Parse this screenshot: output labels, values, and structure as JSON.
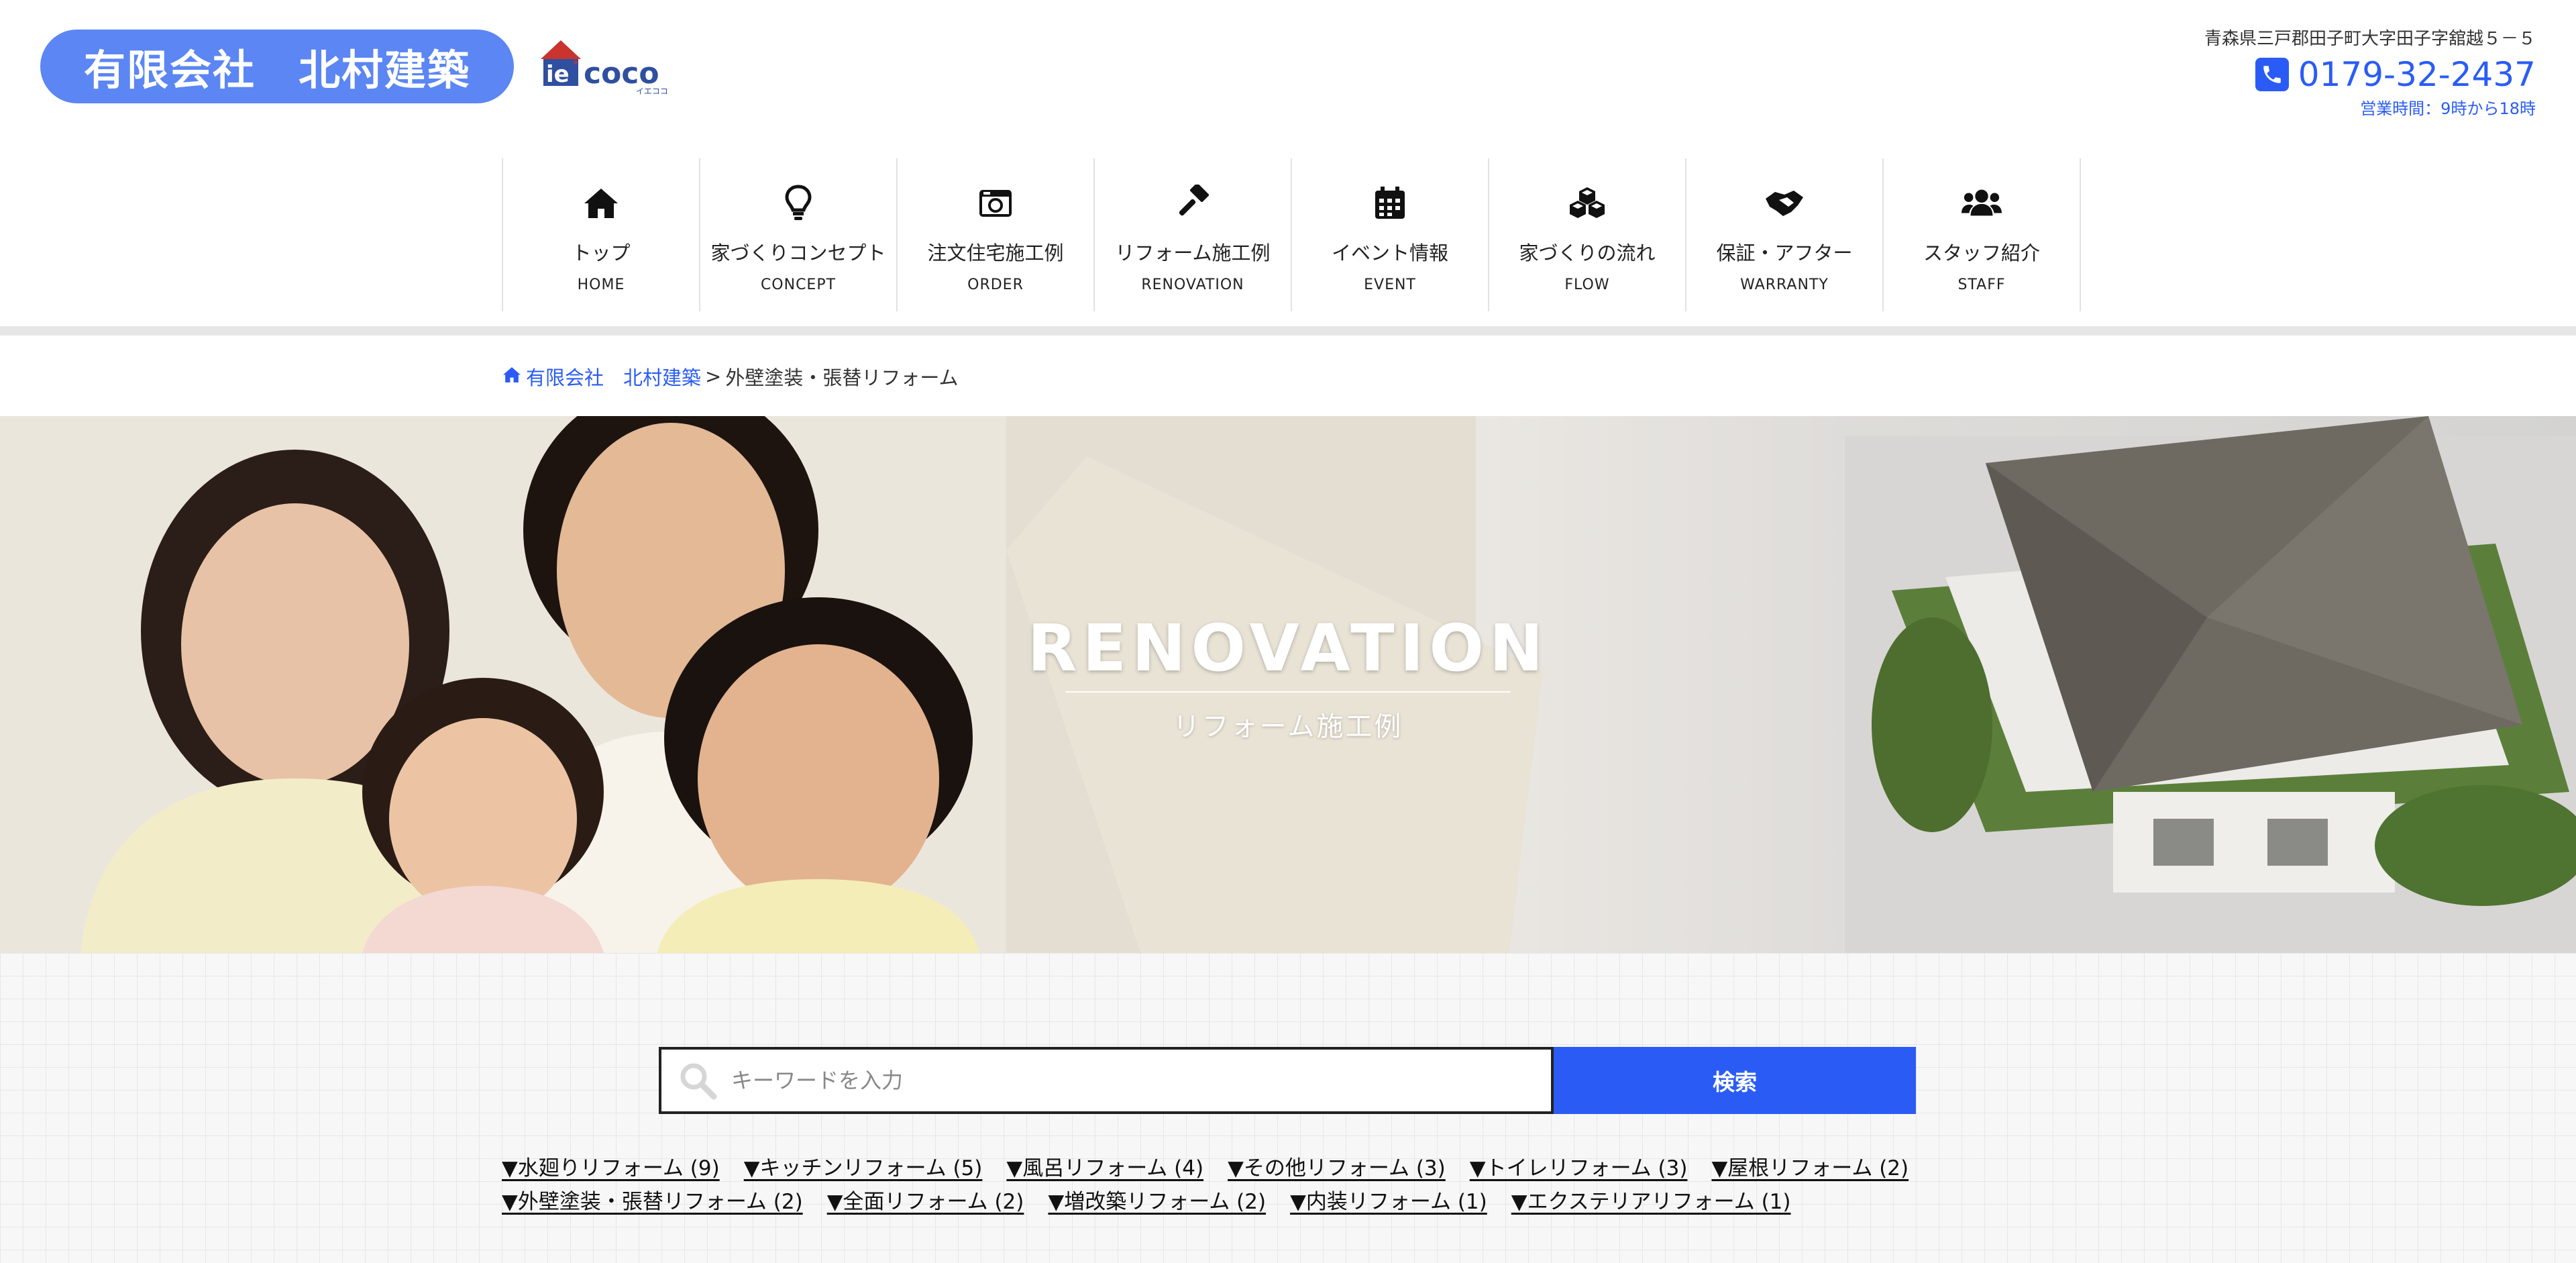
{
  "header": {
    "company_name": "有限会社　北村建築",
    "logo_text": "coco",
    "logo_sub": "イエココ",
    "address": "青森県三戸郡田子町大字田子字舘越５－５",
    "phone": "0179-32-2437",
    "hours": "営業時間：9時から18時"
  },
  "nav": {
    "items": [
      {
        "label": "トップ",
        "sub": "HOME",
        "icon": "home-icon"
      },
      {
        "label": "家づくりコンセプト",
        "sub": "CONCEPT",
        "icon": "lightbulb-icon"
      },
      {
        "label": "注文住宅施工例",
        "sub": "ORDER",
        "icon": "camera-icon"
      },
      {
        "label": "リフォーム施工例",
        "sub": "RENOVATION",
        "icon": "hammer-icon"
      },
      {
        "label": "イベント情報",
        "sub": "EVENT",
        "icon": "calendar-icon"
      },
      {
        "label": "家づくりの流れ",
        "sub": "FLOW",
        "icon": "cubes-icon"
      },
      {
        "label": "保証・アフター",
        "sub": "WARRANTY",
        "icon": "handshake-icon"
      },
      {
        "label": "スタッフ紹介",
        "sub": "STAFF",
        "icon": "users-icon"
      }
    ]
  },
  "breadcrumb": {
    "home": "有限会社　北村建築",
    "separator": ">",
    "current": "外壁塗装・張替リフォーム"
  },
  "hero": {
    "title": "RENOVATION",
    "subtitle": "リフォーム施工例"
  },
  "search": {
    "placeholder": "キーワードを入力",
    "button": "検索"
  },
  "categories": {
    "row1": [
      "▼水廻りリフォーム (9)",
      "▼キッチンリフォーム (5)",
      "▼風呂リフォーム (4)",
      "▼その他リフォーム (3)",
      "▼トイレリフォーム (3)",
      "▼屋根リフォーム (2)"
    ],
    "row2": [
      "▼外壁塗装・張替リフォーム (2)",
      "▼全面リフォーム (2)",
      "▼増改築リフォーム (2)",
      "▼内装リフォーム (1)",
      "▼エクステリアリフォーム (1)"
    ]
  },
  "colors": {
    "accent": "#2a5cf5",
    "pill": "#5b86f3"
  }
}
